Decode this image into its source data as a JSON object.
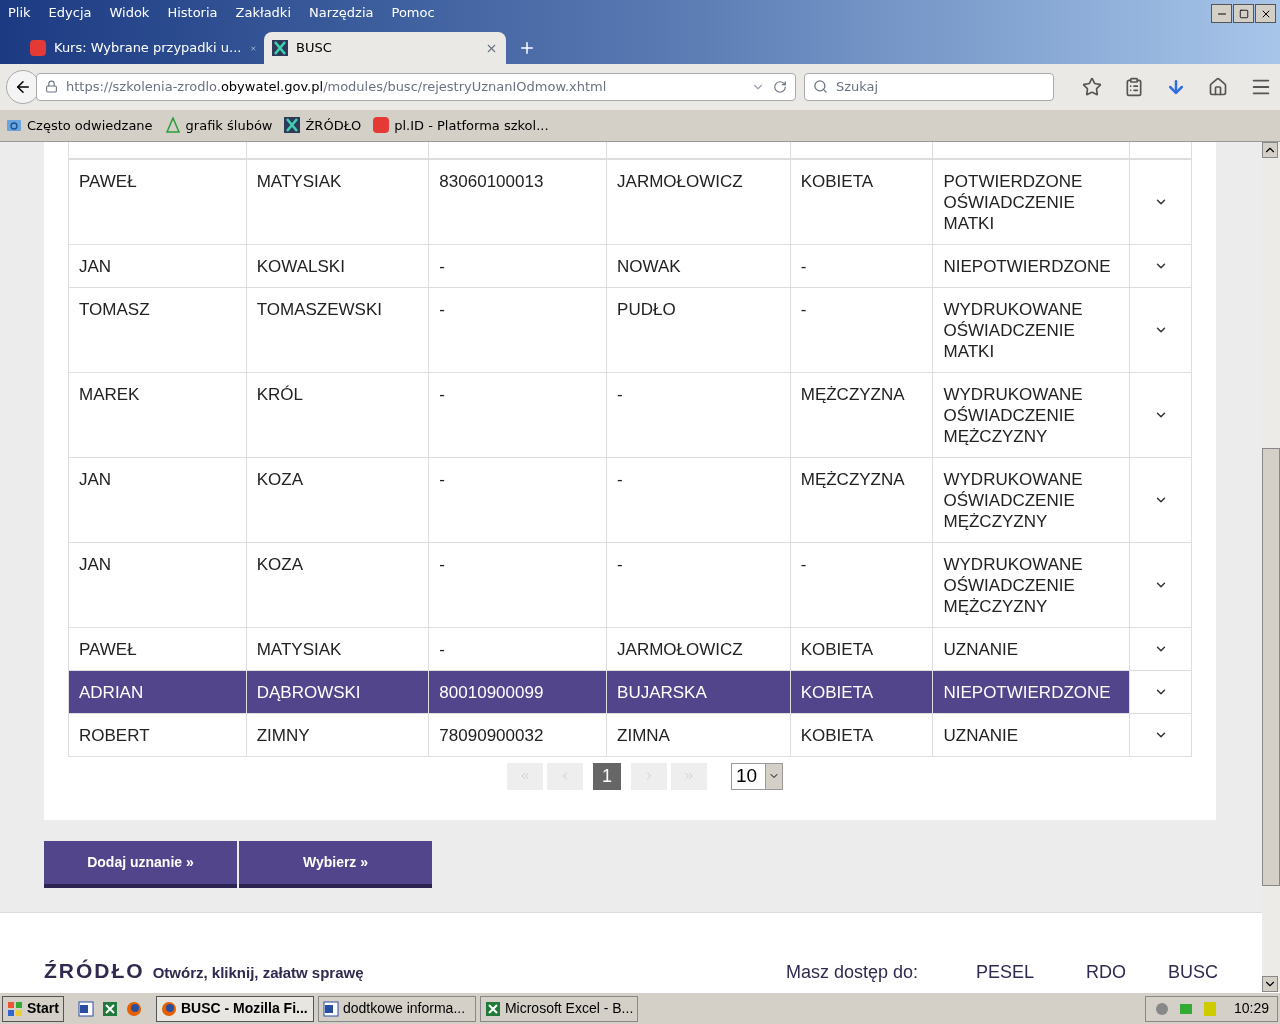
{
  "menu_bar": [
    "Plik",
    "Edycja",
    "Widok",
    "Historia",
    "Zakładki",
    "Narzędzia",
    "Pomoc"
  ],
  "tabs": [
    {
      "label": "Kurs: Wybrane przypadki u...",
      "selected": false
    },
    {
      "label": "BUSC",
      "selected": true
    }
  ],
  "address_bar": {
    "url_prefix": "https://szkolenia-zrodlo.",
    "url_domain": "obywatel.gov.pl",
    "url_path": "/modules/busc/rejestryUznanIOdmow.xhtml"
  },
  "search": {
    "placeholder": "Szukaj"
  },
  "bookmarks": [
    {
      "label": "Często odwiedzane"
    },
    {
      "label": "grafik ślubów"
    },
    {
      "label": "ŹRÓDŁO"
    },
    {
      "label": "pl.ID - Platforma szkol..."
    }
  ],
  "table": {
    "rows": [
      {
        "selected": false,
        "cells": [
          "PAWEŁ",
          "MATYSIAK",
          "83060100013",
          "JARMOŁOWICZ",
          "KOBIETA",
          "POTWIERDZONE OŚWIADCZENIE MATKI"
        ]
      },
      {
        "selected": false,
        "cells": [
          "JAN",
          "KOWALSKI",
          "-",
          "NOWAK",
          "-",
          "NIEPOTWIERDZONE"
        ]
      },
      {
        "selected": false,
        "cells": [
          "TOMASZ",
          "TOMASZEWSKI",
          "-",
          "PUDŁO",
          "-",
          "WYDRUKOWANE OŚWIADCZENIE MATKI"
        ]
      },
      {
        "selected": false,
        "cells": [
          "MAREK",
          "KRÓL",
          "-",
          "-",
          "MĘŻCZYZNA",
          "WYDRUKOWANE OŚWIADCZENIE MĘŻCZYZNY"
        ]
      },
      {
        "selected": false,
        "cells": [
          "JAN",
          "KOZA",
          "-",
          "-",
          "MĘŻCZYZNA",
          "WYDRUKOWANE OŚWIADCZENIE MĘŻCZYZNY"
        ]
      },
      {
        "selected": false,
        "cells": [
          "JAN",
          "KOZA",
          "-",
          "-",
          "-",
          "WYDRUKOWANE OŚWIADCZENIE MĘŻCZYZNY"
        ]
      },
      {
        "selected": false,
        "cells": [
          "PAWEŁ",
          "MATYSIAK",
          "-",
          "JARMOŁOWICZ",
          "KOBIETA",
          "UZNANIE"
        ]
      },
      {
        "selected": true,
        "cells": [
          "ADRIAN",
          "DĄBROWSKI",
          "80010900099",
          "BUJARSKA",
          "KOBIETA",
          "NIEPOTWIERDZONE"
        ]
      },
      {
        "selected": false,
        "cells": [
          "ROBERT",
          "ZIMNY",
          "78090900032",
          "ZIMNA",
          "KOBIETA",
          "UZNANIE"
        ]
      }
    ]
  },
  "pagination": {
    "pages": [
      {
        "label": "1",
        "selected": true
      }
    ],
    "page_size": "10"
  },
  "buttons": [
    "Dodaj uznanie »",
    "Wybierz »"
  ],
  "footer": {
    "logo": "ŹRÓDŁO",
    "tagline": "Otwórz, kliknij, załatw sprawę",
    "access_label": "Masz dostęp do:",
    "access_links": [
      "PESEL",
      "RDO",
      "BUSC"
    ]
  },
  "taskbar": {
    "start": "Start",
    "windows": [
      {
        "label": "BUSC - Mozilla Fi...",
        "selected": true
      },
      {
        "label": "dodtkowe informa...",
        "selected": false
      },
      {
        "label": "Microsoft Excel - B...",
        "selected": false
      }
    ],
    "clock": "10:29"
  }
}
